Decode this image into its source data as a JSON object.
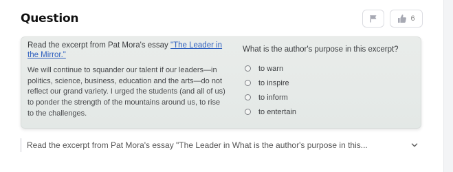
{
  "header": {
    "title": "Question",
    "flag_icon": "flag-icon",
    "like_icon": "thumbs-up-icon",
    "like_count": "6"
  },
  "card": {
    "excerpt": {
      "intro": "Read the excerpt from Pat Mora's essay ",
      "link_text": "\"The Leader in the Mirror.\"",
      "body": "We will continue to squander our talent if our leaders—in politics, science, business, education and the arts—do not reflect our grand variety. I urged the students (and all of us) to ponder the strength of the mountains around us, to rise to the challenges."
    },
    "question": {
      "prompt": "What is the author's purpose in this excerpt?",
      "options": [
        {
          "label": "to warn"
        },
        {
          "label": "to inspire"
        },
        {
          "label": "to inform"
        },
        {
          "label": "to entertain"
        }
      ]
    }
  },
  "footer": {
    "summary": "Read the excerpt from Pat Mora's essay \"The Leader in What is the author's purpose in this...",
    "chevron_icon": "chevron-down-icon"
  }
}
